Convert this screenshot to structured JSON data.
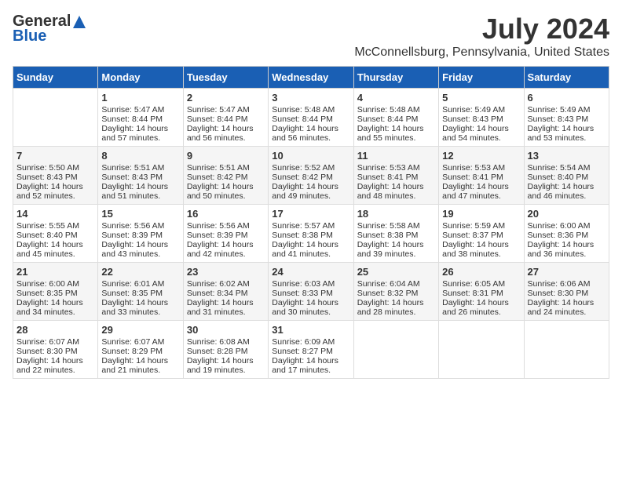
{
  "header": {
    "logo_general": "General",
    "logo_blue": "Blue",
    "title": "July 2024",
    "subtitle": "McConnellsburg, Pennsylvania, United States"
  },
  "days_of_week": [
    "Sunday",
    "Monday",
    "Tuesday",
    "Wednesday",
    "Thursday",
    "Friday",
    "Saturday"
  ],
  "weeks": [
    [
      {
        "day": "",
        "sunrise": "",
        "sunset": "",
        "daylight": ""
      },
      {
        "day": "1",
        "sunrise": "Sunrise: 5:47 AM",
        "sunset": "Sunset: 8:44 PM",
        "daylight": "Daylight: 14 hours and 57 minutes."
      },
      {
        "day": "2",
        "sunrise": "Sunrise: 5:47 AM",
        "sunset": "Sunset: 8:44 PM",
        "daylight": "Daylight: 14 hours and 56 minutes."
      },
      {
        "day": "3",
        "sunrise": "Sunrise: 5:48 AM",
        "sunset": "Sunset: 8:44 PM",
        "daylight": "Daylight: 14 hours and 56 minutes."
      },
      {
        "day": "4",
        "sunrise": "Sunrise: 5:48 AM",
        "sunset": "Sunset: 8:44 PM",
        "daylight": "Daylight: 14 hours and 55 minutes."
      },
      {
        "day": "5",
        "sunrise": "Sunrise: 5:49 AM",
        "sunset": "Sunset: 8:43 PM",
        "daylight": "Daylight: 14 hours and 54 minutes."
      },
      {
        "day": "6",
        "sunrise": "Sunrise: 5:49 AM",
        "sunset": "Sunset: 8:43 PM",
        "daylight": "Daylight: 14 hours and 53 minutes."
      }
    ],
    [
      {
        "day": "7",
        "sunrise": "Sunrise: 5:50 AM",
        "sunset": "Sunset: 8:43 PM",
        "daylight": "Daylight: 14 hours and 52 minutes."
      },
      {
        "day": "8",
        "sunrise": "Sunrise: 5:51 AM",
        "sunset": "Sunset: 8:43 PM",
        "daylight": "Daylight: 14 hours and 51 minutes."
      },
      {
        "day": "9",
        "sunrise": "Sunrise: 5:51 AM",
        "sunset": "Sunset: 8:42 PM",
        "daylight": "Daylight: 14 hours and 50 minutes."
      },
      {
        "day": "10",
        "sunrise": "Sunrise: 5:52 AM",
        "sunset": "Sunset: 8:42 PM",
        "daylight": "Daylight: 14 hours and 49 minutes."
      },
      {
        "day": "11",
        "sunrise": "Sunrise: 5:53 AM",
        "sunset": "Sunset: 8:41 PM",
        "daylight": "Daylight: 14 hours and 48 minutes."
      },
      {
        "day": "12",
        "sunrise": "Sunrise: 5:53 AM",
        "sunset": "Sunset: 8:41 PM",
        "daylight": "Daylight: 14 hours and 47 minutes."
      },
      {
        "day": "13",
        "sunrise": "Sunrise: 5:54 AM",
        "sunset": "Sunset: 8:40 PM",
        "daylight": "Daylight: 14 hours and 46 minutes."
      }
    ],
    [
      {
        "day": "14",
        "sunrise": "Sunrise: 5:55 AM",
        "sunset": "Sunset: 8:40 PM",
        "daylight": "Daylight: 14 hours and 45 minutes."
      },
      {
        "day": "15",
        "sunrise": "Sunrise: 5:56 AM",
        "sunset": "Sunset: 8:39 PM",
        "daylight": "Daylight: 14 hours and 43 minutes."
      },
      {
        "day": "16",
        "sunrise": "Sunrise: 5:56 AM",
        "sunset": "Sunset: 8:39 PM",
        "daylight": "Daylight: 14 hours and 42 minutes."
      },
      {
        "day": "17",
        "sunrise": "Sunrise: 5:57 AM",
        "sunset": "Sunset: 8:38 PM",
        "daylight": "Daylight: 14 hours and 41 minutes."
      },
      {
        "day": "18",
        "sunrise": "Sunrise: 5:58 AM",
        "sunset": "Sunset: 8:38 PM",
        "daylight": "Daylight: 14 hours and 39 minutes."
      },
      {
        "day": "19",
        "sunrise": "Sunrise: 5:59 AM",
        "sunset": "Sunset: 8:37 PM",
        "daylight": "Daylight: 14 hours and 38 minutes."
      },
      {
        "day": "20",
        "sunrise": "Sunrise: 6:00 AM",
        "sunset": "Sunset: 8:36 PM",
        "daylight": "Daylight: 14 hours and 36 minutes."
      }
    ],
    [
      {
        "day": "21",
        "sunrise": "Sunrise: 6:00 AM",
        "sunset": "Sunset: 8:35 PM",
        "daylight": "Daylight: 14 hours and 34 minutes."
      },
      {
        "day": "22",
        "sunrise": "Sunrise: 6:01 AM",
        "sunset": "Sunset: 8:35 PM",
        "daylight": "Daylight: 14 hours and 33 minutes."
      },
      {
        "day": "23",
        "sunrise": "Sunrise: 6:02 AM",
        "sunset": "Sunset: 8:34 PM",
        "daylight": "Daylight: 14 hours and 31 minutes."
      },
      {
        "day": "24",
        "sunrise": "Sunrise: 6:03 AM",
        "sunset": "Sunset: 8:33 PM",
        "daylight": "Daylight: 14 hours and 30 minutes."
      },
      {
        "day": "25",
        "sunrise": "Sunrise: 6:04 AM",
        "sunset": "Sunset: 8:32 PM",
        "daylight": "Daylight: 14 hours and 28 minutes."
      },
      {
        "day": "26",
        "sunrise": "Sunrise: 6:05 AM",
        "sunset": "Sunset: 8:31 PM",
        "daylight": "Daylight: 14 hours and 26 minutes."
      },
      {
        "day": "27",
        "sunrise": "Sunrise: 6:06 AM",
        "sunset": "Sunset: 8:30 PM",
        "daylight": "Daylight: 14 hours and 24 minutes."
      }
    ],
    [
      {
        "day": "28",
        "sunrise": "Sunrise: 6:07 AM",
        "sunset": "Sunset: 8:30 PM",
        "daylight": "Daylight: 14 hours and 22 minutes."
      },
      {
        "day": "29",
        "sunrise": "Sunrise: 6:07 AM",
        "sunset": "Sunset: 8:29 PM",
        "daylight": "Daylight: 14 hours and 21 minutes."
      },
      {
        "day": "30",
        "sunrise": "Sunrise: 6:08 AM",
        "sunset": "Sunset: 8:28 PM",
        "daylight": "Daylight: 14 hours and 19 minutes."
      },
      {
        "day": "31",
        "sunrise": "Sunrise: 6:09 AM",
        "sunset": "Sunset: 8:27 PM",
        "daylight": "Daylight: 14 hours and 17 minutes."
      },
      {
        "day": "",
        "sunrise": "",
        "sunset": "",
        "daylight": ""
      },
      {
        "day": "",
        "sunrise": "",
        "sunset": "",
        "daylight": ""
      },
      {
        "day": "",
        "sunrise": "",
        "sunset": "",
        "daylight": ""
      }
    ]
  ]
}
